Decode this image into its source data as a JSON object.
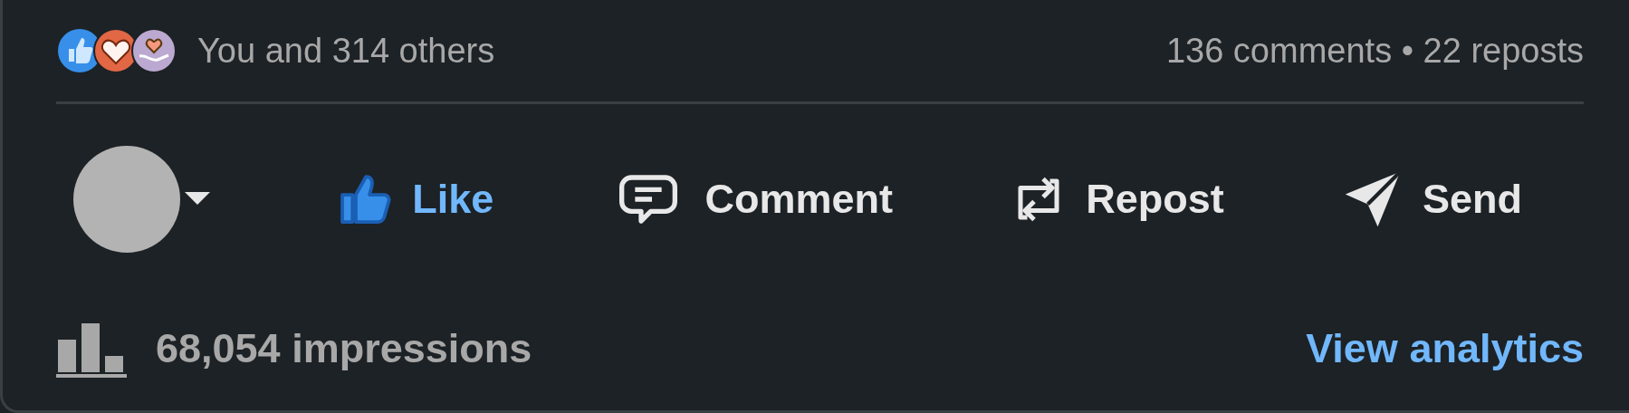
{
  "social_counts": {
    "reactions_summary": "You and 314 others",
    "comments_reposts": "136 comments • 22 reposts"
  },
  "actions": [
    {
      "kind": "like",
      "label": "Like",
      "selected": true
    },
    {
      "kind": "comment",
      "label": "Comment",
      "selected": false
    },
    {
      "kind": "repost",
      "label": "Repost",
      "selected": false
    },
    {
      "kind": "send",
      "label": "Send",
      "selected": false
    }
  ],
  "footer": {
    "impressions": "68,054 impressions",
    "analytics_link": "View analytics"
  }
}
